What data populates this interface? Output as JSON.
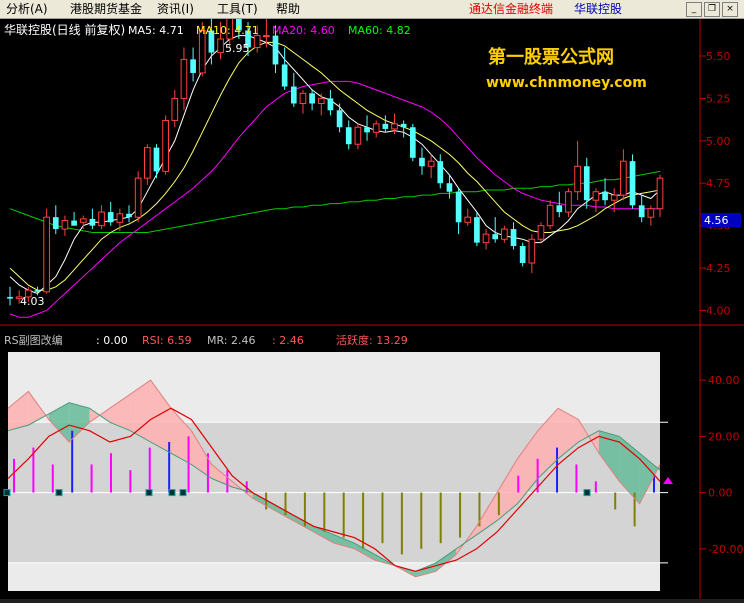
{
  "menu": {
    "items": [
      "分析(A)",
      "港股期货基金",
      "资讯(I)",
      "工具(T)",
      "帮助"
    ],
    "promo": "通达信金融终端",
    "stock": "华联控股"
  },
  "price_panel": {
    "title": "华联控股(日线 前复权)",
    "indicators": [
      {
        "label": "MA5: 4.71",
        "color": "#ffffff"
      },
      {
        "label": "MA10: 4.71",
        "color": "#ffff00"
      },
      {
        "label": "MA20: 4.60",
        "color": "#ff00ff"
      },
      {
        "label": "MA60: 4.82",
        "color": "#00ff00"
      }
    ],
    "watermark_title": "第一股票公式网",
    "watermark_url": "www.chnmoney.com",
    "high_label": "5.95",
    "low_label": "4.03",
    "current_price": "4.56",
    "y_ticks": [
      "5.50",
      "5.25",
      "5.00",
      "4.75",
      "4.50",
      "4.25",
      "4.00"
    ]
  },
  "indicator_panel": {
    "title": "RS副图改编",
    "values": [
      {
        "label": ": 0.00",
        "color": "#ffffff"
      },
      {
        "label": "RSI: 6.59",
        "color": "#ff5555"
      },
      {
        "label": "MR: 2.46",
        "color": "#c0c0c0"
      },
      {
        "label": ": 2.46",
        "color": "#ff5555"
      },
      {
        "label": "活跃度: 13.29",
        "color": "#ff5555"
      }
    ],
    "y_ticks": [
      "40.00",
      "20.00",
      "0.00",
      "-20.00"
    ]
  },
  "chart_data": {
    "type": "candlestick",
    "ylim": [
      3.95,
      5.6
    ],
    "candles": [
      [
        4.08,
        4.14,
        4.03,
        4.07
      ],
      [
        4.07,
        4.12,
        4.04,
        4.08
      ],
      [
        4.08,
        4.14,
        4.05,
        4.12
      ],
      [
        4.12,
        4.14,
        4.09,
        4.11
      ],
      [
        4.11,
        4.6,
        4.1,
        4.55
      ],
      [
        4.55,
        4.62,
        4.45,
        4.48
      ],
      [
        4.48,
        4.56,
        4.44,
        4.53
      ],
      [
        4.53,
        4.58,
        4.5,
        4.5
      ],
      [
        4.52,
        4.56,
        4.48,
        4.54
      ],
      [
        4.54,
        4.6,
        4.48,
        4.5
      ],
      [
        4.5,
        4.62,
        4.48,
        4.58
      ],
      [
        4.58,
        4.64,
        4.5,
        4.52
      ],
      [
        4.52,
        4.6,
        4.47,
        4.57
      ],
      [
        4.57,
        4.62,
        4.52,
        4.55
      ],
      [
        4.55,
        4.82,
        4.52,
        4.78
      ],
      [
        4.78,
        4.98,
        4.74,
        4.96
      ],
      [
        4.96,
        4.98,
        4.78,
        4.82
      ],
      [
        4.82,
        5.15,
        4.8,
        5.12
      ],
      [
        5.12,
        5.3,
        5.08,
        5.25
      ],
      [
        5.25,
        5.55,
        5.18,
        5.48
      ],
      [
        5.48,
        5.55,
        5.35,
        5.4
      ],
      [
        5.4,
        5.7,
        5.38,
        5.65
      ],
      [
        5.65,
        5.72,
        5.45,
        5.52
      ],
      [
        5.52,
        5.7,
        5.48,
        5.6
      ],
      [
        5.6,
        5.95,
        5.55,
        5.82
      ],
      [
        5.82,
        5.9,
        5.6,
        5.65
      ],
      [
        5.65,
        5.7,
        5.5,
        5.55
      ],
      [
        5.55,
        5.68,
        5.52,
        5.62
      ],
      [
        5.62,
        5.85,
        5.55,
        5.62
      ],
      [
        5.62,
        5.68,
        5.4,
        5.45
      ],
      [
        5.45,
        5.55,
        5.3,
        5.32
      ],
      [
        5.32,
        5.4,
        5.2,
        5.22
      ],
      [
        5.22,
        5.3,
        5.16,
        5.28
      ],
      [
        5.28,
        5.3,
        5.18,
        5.22
      ],
      [
        5.22,
        5.28,
        5.15,
        5.25
      ],
      [
        5.25,
        5.3,
        5.15,
        5.18
      ],
      [
        5.18,
        5.22,
        5.05,
        5.08
      ],
      [
        5.08,
        5.12,
        4.95,
        4.98
      ],
      [
        4.98,
        5.1,
        4.95,
        5.08
      ],
      [
        5.08,
        5.15,
        5.0,
        5.05
      ],
      [
        5.05,
        5.12,
        5.02,
        5.1
      ],
      [
        5.1,
        5.15,
        5.05,
        5.07
      ],
      [
        5.07,
        5.16,
        5.04,
        5.1
      ],
      [
        5.1,
        5.12,
        5.02,
        5.08
      ],
      [
        5.08,
        5.1,
        4.88,
        4.9
      ],
      [
        4.9,
        4.96,
        4.8,
        4.85
      ],
      [
        4.85,
        4.92,
        4.78,
        4.88
      ],
      [
        4.88,
        4.92,
        4.72,
        4.75
      ],
      [
        4.75,
        4.8,
        4.66,
        4.7
      ],
      [
        4.7,
        4.72,
        4.45,
        4.52
      ],
      [
        4.52,
        4.6,
        4.5,
        4.55
      ],
      [
        4.55,
        4.58,
        4.38,
        4.4
      ],
      [
        4.4,
        4.48,
        4.36,
        4.45
      ],
      [
        4.45,
        4.55,
        4.4,
        4.42
      ],
      [
        4.42,
        4.5,
        4.4,
        4.48
      ],
      [
        4.48,
        4.52,
        4.36,
        4.38
      ],
      [
        4.38,
        4.4,
        4.26,
        4.28
      ],
      [
        4.28,
        4.45,
        4.22,
        4.42
      ],
      [
        4.42,
        4.52,
        4.4,
        4.5
      ],
      [
        4.5,
        4.65,
        4.48,
        4.62
      ],
      [
        4.62,
        4.7,
        4.55,
        4.58
      ],
      [
        4.58,
        4.72,
        4.55,
        4.7
      ],
      [
        4.7,
        5.0,
        4.65,
        4.85
      ],
      [
        4.85,
        4.9,
        4.6,
        4.65
      ],
      [
        4.65,
        4.72,
        4.58,
        4.7
      ],
      [
        4.7,
        4.78,
        4.62,
        4.65
      ],
      [
        4.65,
        4.72,
        4.58,
        4.68
      ],
      [
        4.68,
        4.95,
        4.65,
        4.88
      ],
      [
        4.88,
        4.92,
        4.6,
        4.62
      ],
      [
        4.62,
        4.68,
        4.52,
        4.55
      ],
      [
        4.55,
        4.62,
        4.5,
        4.6
      ],
      [
        4.6,
        4.8,
        4.55,
        4.78
      ]
    ],
    "ma5": [
      4.2,
      4.15,
      4.12,
      4.1,
      4.15,
      4.2,
      4.3,
      4.42,
      4.5,
      4.52,
      4.52,
      4.53,
      4.54,
      4.55,
      4.6,
      4.7,
      4.8,
      4.9,
      5.0,
      5.15,
      5.3,
      5.42,
      5.5,
      5.55,
      5.6,
      5.62,
      5.62,
      5.6,
      5.58,
      5.55,
      5.48,
      5.42,
      5.36,
      5.3,
      5.26,
      5.24,
      5.2,
      5.14,
      5.1,
      5.08,
      5.06,
      5.05,
      5.06,
      5.05,
      5.02,
      4.98,
      4.92,
      4.86,
      4.8,
      4.72,
      4.65,
      4.58,
      4.5,
      4.46,
      4.44,
      4.43,
      4.42,
      4.4,
      4.4,
      4.44,
      4.48,
      4.53,
      4.6,
      4.64,
      4.68,
      4.7,
      4.68,
      4.68,
      4.7,
      4.68,
      4.66,
      4.71
    ],
    "ma10": [
      4.25,
      4.2,
      4.15,
      4.12,
      4.12,
      4.14,
      4.18,
      4.24,
      4.3,
      4.36,
      4.42,
      4.46,
      4.49,
      4.51,
      4.54,
      4.58,
      4.63,
      4.69,
      4.76,
      4.84,
      4.94,
      5.05,
      5.16,
      5.27,
      5.37,
      5.46,
      5.52,
      5.56,
      5.58,
      5.58,
      5.56,
      5.52,
      5.48,
      5.44,
      5.4,
      5.35,
      5.3,
      5.26,
      5.22,
      5.18,
      5.15,
      5.12,
      5.1,
      5.08,
      5.06,
      5.03,
      5.0,
      4.96,
      4.92,
      4.87,
      4.81,
      4.76,
      4.7,
      4.64,
      4.58,
      4.54,
      4.5,
      4.47,
      4.46,
      4.46,
      4.47,
      4.48,
      4.5,
      4.53,
      4.56,
      4.6,
      4.63,
      4.66,
      4.68,
      4.69,
      4.7,
      4.71
    ],
    "ma20": [
      3.98,
      3.96,
      3.96,
      3.98,
      4.0,
      4.05,
      4.1,
      4.15,
      4.2,
      4.25,
      4.3,
      4.35,
      4.4,
      4.44,
      4.48,
      4.52,
      4.56,
      4.6,
      4.64,
      4.68,
      4.72,
      4.77,
      4.82,
      4.88,
      4.95,
      5.02,
      5.08,
      5.14,
      5.2,
      5.24,
      5.28,
      5.3,
      5.32,
      5.33,
      5.34,
      5.35,
      5.35,
      5.35,
      5.34,
      5.32,
      5.3,
      5.28,
      5.26,
      5.24,
      5.22,
      5.2,
      5.17,
      5.13,
      5.08,
      5.02,
      4.96,
      4.9,
      4.85,
      4.8,
      4.76,
      4.72,
      4.69,
      4.67,
      4.65,
      4.64,
      4.63,
      4.62,
      4.62,
      4.62,
      4.61,
      4.61,
      4.6,
      4.6,
      4.6,
      4.6,
      4.6,
      4.6
    ],
    "ma60": [
      4.6,
      4.58,
      4.56,
      4.54,
      4.52,
      4.5,
      4.49,
      4.48,
      4.47,
      4.46,
      4.46,
      4.46,
      4.46,
      4.46,
      4.46,
      4.46,
      4.47,
      4.48,
      4.49,
      4.5,
      4.51,
      4.52,
      4.53,
      4.54,
      4.55,
      4.56,
      4.57,
      4.58,
      4.59,
      4.6,
      4.6,
      4.61,
      4.61,
      4.62,
      4.62,
      4.63,
      4.63,
      4.64,
      4.64,
      4.65,
      4.65,
      4.66,
      4.66,
      4.67,
      4.67,
      4.68,
      4.68,
      4.69,
      4.69,
      4.7,
      4.7,
      4.7,
      4.71,
      4.71,
      4.71,
      4.72,
      4.72,
      4.72,
      4.73,
      4.73,
      4.74,
      4.74,
      4.75,
      4.75,
      4.76,
      4.77,
      4.77,
      4.78,
      4.79,
      4.8,
      4.81,
      4.82
    ],
    "indicator": {
      "ylim": [
        -35,
        50
      ],
      "band_line": [
        22,
        24,
        28,
        32,
        30,
        25,
        22,
        18,
        14,
        10,
        5,
        2,
        0,
        -4,
        -8,
        -12,
        -15,
        -18,
        -22,
        -26,
        -28,
        -25,
        -20,
        -15,
        -10,
        -4,
        5,
        12,
        18,
        22,
        20,
        14,
        8
      ],
      "band_upper": [
        30,
        36,
        26,
        18,
        25,
        30,
        35,
        40,
        30,
        22,
        10,
        4,
        -2,
        -6,
        -10,
        -14,
        -18,
        -20,
        -24,
        -26,
        -30,
        -28,
        -22,
        -12,
        0,
        12,
        22,
        30,
        26,
        14,
        4,
        -4,
        10
      ],
      "red_line": [
        5,
        12,
        20,
        24,
        22,
        18,
        20,
        26,
        30,
        26,
        16,
        6,
        0,
        -4,
        -8,
        -12,
        -14,
        -16,
        -20,
        -26,
        -28,
        -26,
        -24,
        -20,
        -14,
        -6,
        2,
        10,
        16,
        20,
        18,
        12,
        4
      ],
      "bars": [
        12,
        16,
        10,
        22,
        10,
        14,
        8,
        16,
        18,
        20,
        14,
        8,
        4,
        -6,
        -8,
        -12,
        -14,
        -16,
        -20,
        -18,
        -22,
        -20,
        -18,
        -16,
        -12,
        -8,
        6,
        12,
        16,
        10,
        4,
        -6,
        -12,
        6
      ],
      "bands": {
        "upper": 25,
        "lower": -25
      }
    }
  }
}
